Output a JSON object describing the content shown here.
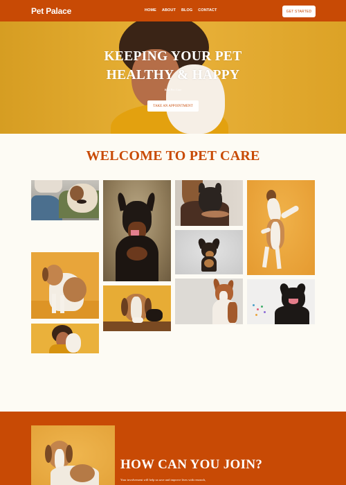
{
  "nav": {
    "brand": "Pet Palace",
    "links": [
      "HOME",
      "ABOUT",
      "BLOG",
      "CONTACT"
    ],
    "cta": "GET STARTED"
  },
  "hero": {
    "title_line1": "KEEPING YOUR PET",
    "title_line2": "HEALTHY & HAPPY",
    "subtitle": "Best Pet Care",
    "button": "TAKE AN APPOINTMENT"
  },
  "welcome": {
    "title": "WELCOME TO PET CARE"
  },
  "gallery": {
    "photos": [
      "bulldog-on-lap",
      "doberman",
      "woman-holding-french-bulldog",
      "dog-jumping",
      "chihuahua",
      "beagle-sitting",
      "beagle-lying",
      "basenji",
      "black-french-bulldog",
      "woman-with-white-dog"
    ]
  },
  "join": {
    "title": "HOW CAN YOU JOIN?",
    "text": "Your involvement will help us save and improve lives with research,"
  },
  "colors": {
    "accent": "#c84a05",
    "hero_bg": "#e2a92b",
    "page_bg": "#fdfbf4"
  }
}
